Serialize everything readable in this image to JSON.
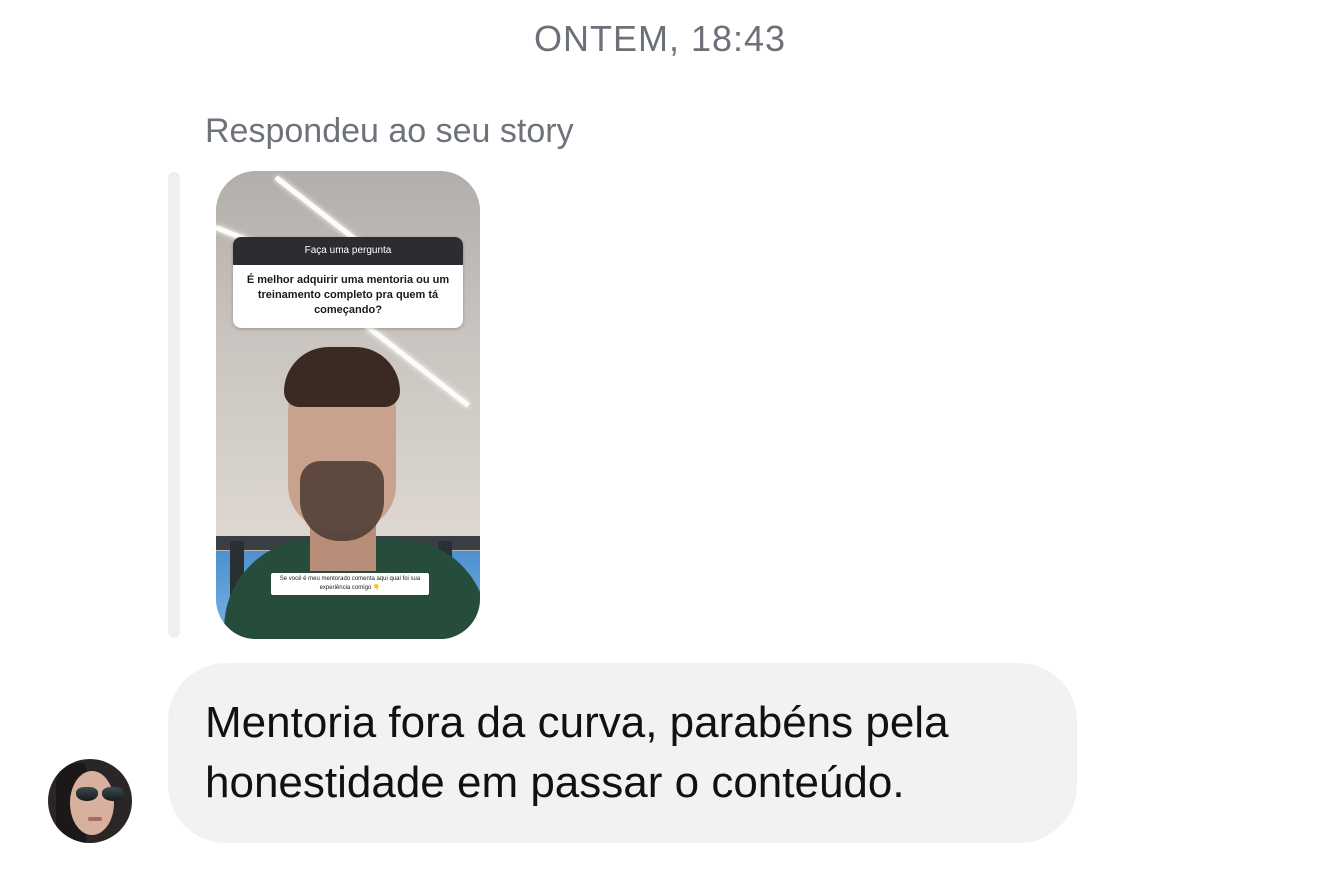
{
  "header": {
    "timestamp": "ONTEM, 18:43"
  },
  "reply": {
    "label": "Respondeu ao seu story"
  },
  "story": {
    "question_header": "Faça uma pergunta",
    "question_text": "É melhor adquirir uma mentoria ou um treinamento completo pra quem tá começando?",
    "caption": "Se você é meu mentorado comenta aqui qual foi sua experiência comigo 👇"
  },
  "message": {
    "text": "Mentoria fora da curva, parabéns pela honestidade em passar o conteúdo."
  },
  "colors": {
    "bubble_background": "#f1f2f4",
    "secondary_text": "#6b7079",
    "message_text": "#111111"
  }
}
